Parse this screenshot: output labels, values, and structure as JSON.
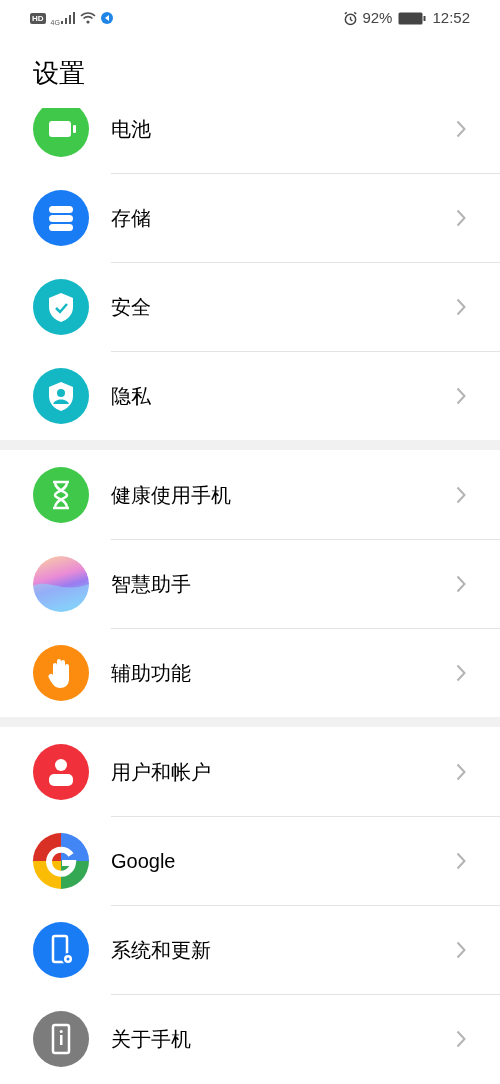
{
  "status_bar": {
    "hd": "HD",
    "network": "4G",
    "battery_percent": "92%",
    "time": "12:52"
  },
  "title": "设置",
  "groups": [
    {
      "items": [
        {
          "kind": "battery",
          "label": "电池"
        },
        {
          "kind": "storage",
          "label": "存储"
        },
        {
          "kind": "security",
          "label": "安全"
        },
        {
          "kind": "privacy",
          "label": "隐私"
        }
      ]
    },
    {
      "items": [
        {
          "kind": "hourglass",
          "label": "健康使用手机"
        },
        {
          "kind": "assistant",
          "label": "智慧助手"
        },
        {
          "kind": "hand",
          "label": "辅助功能"
        }
      ]
    },
    {
      "items": [
        {
          "kind": "user",
          "label": "用户和帐户"
        },
        {
          "kind": "google",
          "label": "Google"
        },
        {
          "kind": "update",
          "label": "系统和更新"
        },
        {
          "kind": "phone",
          "label": "关于手机"
        }
      ]
    }
  ]
}
